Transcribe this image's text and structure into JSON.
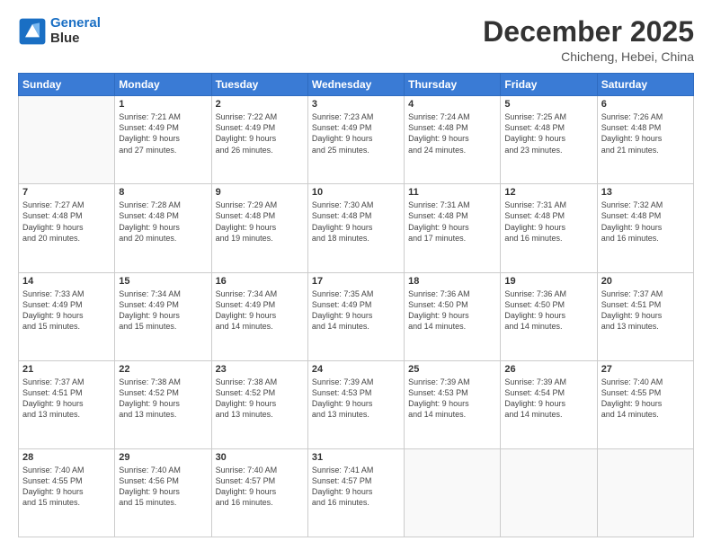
{
  "header": {
    "logo_line1": "General",
    "logo_line2": "Blue",
    "month": "December 2025",
    "location": "Chicheng, Hebei, China"
  },
  "weekdays": [
    "Sunday",
    "Monday",
    "Tuesday",
    "Wednesday",
    "Thursday",
    "Friday",
    "Saturday"
  ],
  "weeks": [
    [
      {
        "day": "",
        "info": ""
      },
      {
        "day": "1",
        "info": "Sunrise: 7:21 AM\nSunset: 4:49 PM\nDaylight: 9 hours\nand 27 minutes."
      },
      {
        "day": "2",
        "info": "Sunrise: 7:22 AM\nSunset: 4:49 PM\nDaylight: 9 hours\nand 26 minutes."
      },
      {
        "day": "3",
        "info": "Sunrise: 7:23 AM\nSunset: 4:49 PM\nDaylight: 9 hours\nand 25 minutes."
      },
      {
        "day": "4",
        "info": "Sunrise: 7:24 AM\nSunset: 4:48 PM\nDaylight: 9 hours\nand 24 minutes."
      },
      {
        "day": "5",
        "info": "Sunrise: 7:25 AM\nSunset: 4:48 PM\nDaylight: 9 hours\nand 23 minutes."
      },
      {
        "day": "6",
        "info": "Sunrise: 7:26 AM\nSunset: 4:48 PM\nDaylight: 9 hours\nand 21 minutes."
      }
    ],
    [
      {
        "day": "7",
        "info": "Sunrise: 7:27 AM\nSunset: 4:48 PM\nDaylight: 9 hours\nand 20 minutes."
      },
      {
        "day": "8",
        "info": "Sunrise: 7:28 AM\nSunset: 4:48 PM\nDaylight: 9 hours\nand 20 minutes."
      },
      {
        "day": "9",
        "info": "Sunrise: 7:29 AM\nSunset: 4:48 PM\nDaylight: 9 hours\nand 19 minutes."
      },
      {
        "day": "10",
        "info": "Sunrise: 7:30 AM\nSunset: 4:48 PM\nDaylight: 9 hours\nand 18 minutes."
      },
      {
        "day": "11",
        "info": "Sunrise: 7:31 AM\nSunset: 4:48 PM\nDaylight: 9 hours\nand 17 minutes."
      },
      {
        "day": "12",
        "info": "Sunrise: 7:31 AM\nSunset: 4:48 PM\nDaylight: 9 hours\nand 16 minutes."
      },
      {
        "day": "13",
        "info": "Sunrise: 7:32 AM\nSunset: 4:48 PM\nDaylight: 9 hours\nand 16 minutes."
      }
    ],
    [
      {
        "day": "14",
        "info": "Sunrise: 7:33 AM\nSunset: 4:49 PM\nDaylight: 9 hours\nand 15 minutes."
      },
      {
        "day": "15",
        "info": "Sunrise: 7:34 AM\nSunset: 4:49 PM\nDaylight: 9 hours\nand 15 minutes."
      },
      {
        "day": "16",
        "info": "Sunrise: 7:34 AM\nSunset: 4:49 PM\nDaylight: 9 hours\nand 14 minutes."
      },
      {
        "day": "17",
        "info": "Sunrise: 7:35 AM\nSunset: 4:49 PM\nDaylight: 9 hours\nand 14 minutes."
      },
      {
        "day": "18",
        "info": "Sunrise: 7:36 AM\nSunset: 4:50 PM\nDaylight: 9 hours\nand 14 minutes."
      },
      {
        "day": "19",
        "info": "Sunrise: 7:36 AM\nSunset: 4:50 PM\nDaylight: 9 hours\nand 14 minutes."
      },
      {
        "day": "20",
        "info": "Sunrise: 7:37 AM\nSunset: 4:51 PM\nDaylight: 9 hours\nand 13 minutes."
      }
    ],
    [
      {
        "day": "21",
        "info": "Sunrise: 7:37 AM\nSunset: 4:51 PM\nDaylight: 9 hours\nand 13 minutes."
      },
      {
        "day": "22",
        "info": "Sunrise: 7:38 AM\nSunset: 4:52 PM\nDaylight: 9 hours\nand 13 minutes."
      },
      {
        "day": "23",
        "info": "Sunrise: 7:38 AM\nSunset: 4:52 PM\nDaylight: 9 hours\nand 13 minutes."
      },
      {
        "day": "24",
        "info": "Sunrise: 7:39 AM\nSunset: 4:53 PM\nDaylight: 9 hours\nand 13 minutes."
      },
      {
        "day": "25",
        "info": "Sunrise: 7:39 AM\nSunset: 4:53 PM\nDaylight: 9 hours\nand 14 minutes."
      },
      {
        "day": "26",
        "info": "Sunrise: 7:39 AM\nSunset: 4:54 PM\nDaylight: 9 hours\nand 14 minutes."
      },
      {
        "day": "27",
        "info": "Sunrise: 7:40 AM\nSunset: 4:55 PM\nDaylight: 9 hours\nand 14 minutes."
      }
    ],
    [
      {
        "day": "28",
        "info": "Sunrise: 7:40 AM\nSunset: 4:55 PM\nDaylight: 9 hours\nand 15 minutes."
      },
      {
        "day": "29",
        "info": "Sunrise: 7:40 AM\nSunset: 4:56 PM\nDaylight: 9 hours\nand 15 minutes."
      },
      {
        "day": "30",
        "info": "Sunrise: 7:40 AM\nSunset: 4:57 PM\nDaylight: 9 hours\nand 16 minutes."
      },
      {
        "day": "31",
        "info": "Sunrise: 7:41 AM\nSunset: 4:57 PM\nDaylight: 9 hours\nand 16 minutes."
      },
      {
        "day": "",
        "info": ""
      },
      {
        "day": "",
        "info": ""
      },
      {
        "day": "",
        "info": ""
      }
    ]
  ]
}
